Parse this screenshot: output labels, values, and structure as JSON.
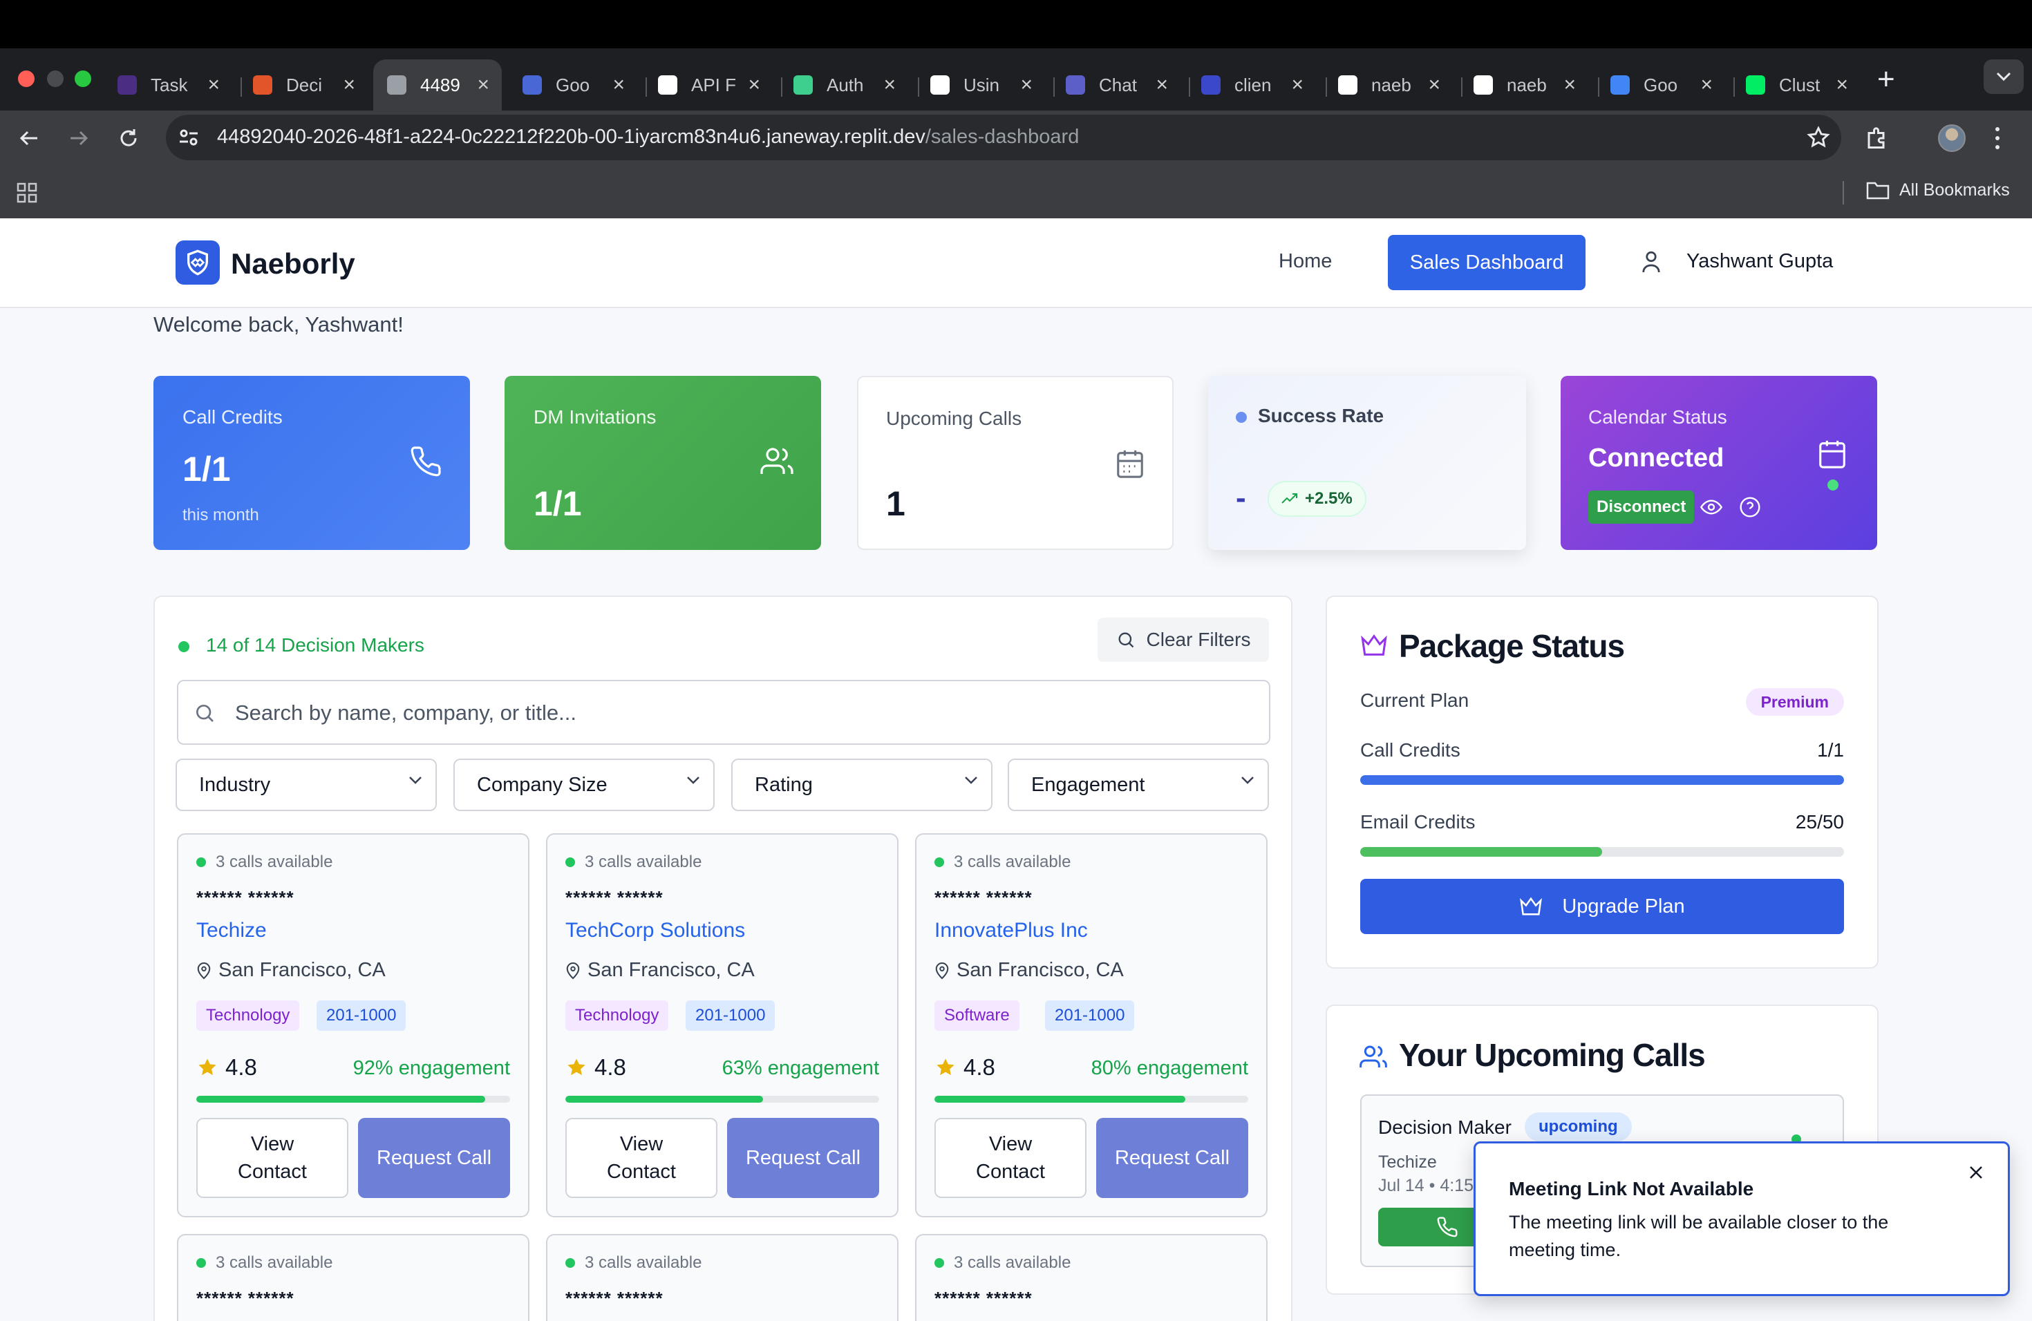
{
  "browser": {
    "tabs": [
      {
        "label": "Task",
        "icon": "app-icon",
        "color": "#4b2d83"
      },
      {
        "label": "Deci",
        "icon": "make-icon",
        "color": "#e2552b"
      },
      {
        "label": "4489",
        "icon": "globe-icon",
        "color": "#9aa0a6"
      },
      {
        "label": "Goo",
        "icon": "shield-icon",
        "color": "#4a67d6"
      },
      {
        "label": "API F",
        "icon": "google-icon",
        "color": "#ffffff"
      },
      {
        "label": "Auth",
        "icon": "supabase-icon",
        "color": "#3ecf8e"
      },
      {
        "label": "Usin",
        "icon": "google-icon",
        "color": "#ffffff"
      },
      {
        "label": "Chat",
        "icon": "teams-icon",
        "color": "#5b5fc7"
      },
      {
        "label": "clien",
        "icon": "tl-icon",
        "color": "#3a48c9"
      },
      {
        "label": "naeb",
        "icon": "naeb-icon",
        "color": "#ffffff"
      },
      {
        "label": "naeb",
        "icon": "naeb-icon",
        "color": "#ffffff"
      },
      {
        "label": "Goo",
        "icon": "calendar-icon",
        "color": "#4285f4"
      },
      {
        "label": "Clust",
        "icon": "mongodb-icon",
        "color": "#00ed64"
      }
    ],
    "url_main": "44892040-2026-48f1-a224-0c22212f220b-00-1iyarcm83n4u6.janeway.replit.dev",
    "url_path": "/sales-dashboard",
    "bookmarks_label": "All Bookmarks"
  },
  "nav": {
    "brand": "Naeborly",
    "home": "Home",
    "sales_dashboard": "Sales Dashboard",
    "user": "Yashwant Gupta"
  },
  "welcome": "Welcome back, Yashwant!",
  "stats": {
    "call_credits": {
      "title": "Call Credits",
      "value": "1/1",
      "sub": "this month"
    },
    "dm_invitations": {
      "title": "DM Invitations",
      "value": "1/1"
    },
    "upcoming_calls": {
      "title": "Upcoming Calls",
      "value": "1"
    },
    "success_rate": {
      "title": "Success Rate",
      "value": "-",
      "trend": "+2.5%"
    },
    "calendar_status": {
      "title": "Calendar Status",
      "value": "Connected",
      "disconnect": "Disconnect"
    }
  },
  "decision_makers": {
    "count_label": "14 of 14 Decision Makers",
    "clear_filters": "Clear Filters",
    "search_placeholder": "Search by name, company, or title...",
    "filters": [
      "Industry",
      "Company Size",
      "Rating",
      "Engagement"
    ],
    "cards": [
      {
        "avail": "3 calls available",
        "mask": "****** ******",
        "company": "Techize",
        "location": "San Francisco, CA",
        "industry": "Technology",
        "size": "201-1000",
        "rating": "4.8",
        "engagement": "92% engagement",
        "engagement_pct": 92,
        "view": "View Contact",
        "request": "Request Call"
      },
      {
        "avail": "3 calls available",
        "mask": "****** ******",
        "company": "TechCorp Solutions",
        "location": "San Francisco, CA",
        "industry": "Technology",
        "size": "201-1000",
        "rating": "4.8",
        "engagement": "63% engagement",
        "engagement_pct": 63,
        "view": "View Contact",
        "request": "Request Call"
      },
      {
        "avail": "3 calls available",
        "mask": "****** ******",
        "company": "InnovatePlus Inc",
        "location": "San Francisco, CA",
        "industry": "Software",
        "size": "201-1000",
        "rating": "4.8",
        "engagement": "80% engagement",
        "engagement_pct": 80,
        "view": "View Contact",
        "request": "Request Call"
      }
    ],
    "row2": [
      {
        "avail": "3 calls available",
        "mask": "****** ******"
      },
      {
        "avail": "3 calls available",
        "mask": "****** ******"
      },
      {
        "avail": "3 calls available",
        "mask": "****** ******"
      }
    ]
  },
  "package": {
    "title": "Package Status",
    "current_plan_label": "Current Plan",
    "plan": "Premium",
    "call_credits_label": "Call Credits",
    "call_credits_value": "1/1",
    "call_credits_fill": 1.0,
    "email_credits_label": "Email Credits",
    "email_credits_value": "25/50",
    "email_credits_fill": 0.5,
    "upgrade": "Upgrade Plan"
  },
  "upcoming": {
    "title": "Your Upcoming Calls",
    "name": "Decision Maker",
    "status": "upcoming",
    "company": "Techize",
    "time": "Jul 14 • 4:15"
  },
  "toast": {
    "title": "Meeting Link Not Available",
    "body": "The meeting link will be available closer to the meeting time."
  }
}
